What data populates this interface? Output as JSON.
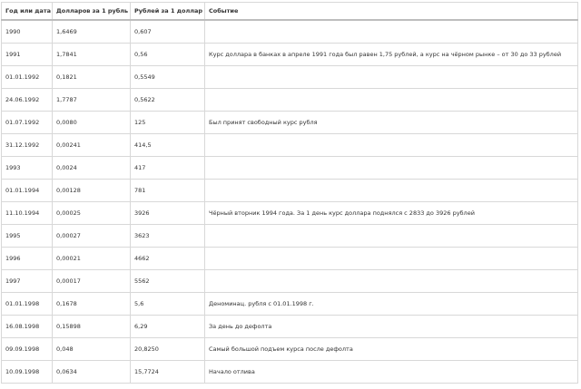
{
  "table": {
    "headers": [
      "Год или дата",
      "Долларов за 1 рубль",
      "Рублей за 1 доллар",
      "Событие"
    ],
    "rows": [
      [
        "1990",
        "1,6469",
        "0,607",
        ""
      ],
      [
        "1991",
        "1,7841",
        "0,56",
        "Курс доллара в банках в апреле 1991 года был равен 1,75 рублей, а курс на чёрном рынке – от 30 до 33 рублей"
      ],
      [
        "01.01.1992",
        "0,1821",
        "0,5549",
        ""
      ],
      [
        "24.06.1992",
        "1,7787",
        "0,5622",
        ""
      ],
      [
        "01.07.1992",
        "0,0080",
        "125",
        "Был принят свободный курс рубля"
      ],
      [
        "31.12.1992",
        "0,00241",
        "414,5",
        ""
      ],
      [
        "1993",
        "0,0024",
        "417",
        ""
      ],
      [
        "01.01.1994",
        "0,00128",
        "781",
        ""
      ],
      [
        "11.10.1994",
        "0,00025",
        "3926",
        "Чёрный вторник 1994 года. За 1 день курс доллара поднялся с 2833 до 3926 рублей"
      ],
      [
        "1995",
        "0,00027",
        "3623",
        ""
      ],
      [
        "1996",
        "0,00021",
        "4662",
        ""
      ],
      [
        "1997",
        "0,00017",
        "5562",
        ""
      ],
      [
        "01.01.1998",
        "0,1678",
        "5,6",
        "Деноминац. рубля с 01.01.1998 г."
      ],
      [
        "16.08.1998",
        "0,15898",
        "6,29",
        "За день до дефолта"
      ],
      [
        "09.09.1998",
        "0,048",
        "20,8250",
        "Самый большой подъем курса после дефолта"
      ],
      [
        "10.09.1998",
        "0,0634",
        "15,7724",
        "Начало отлива"
      ]
    ]
  }
}
